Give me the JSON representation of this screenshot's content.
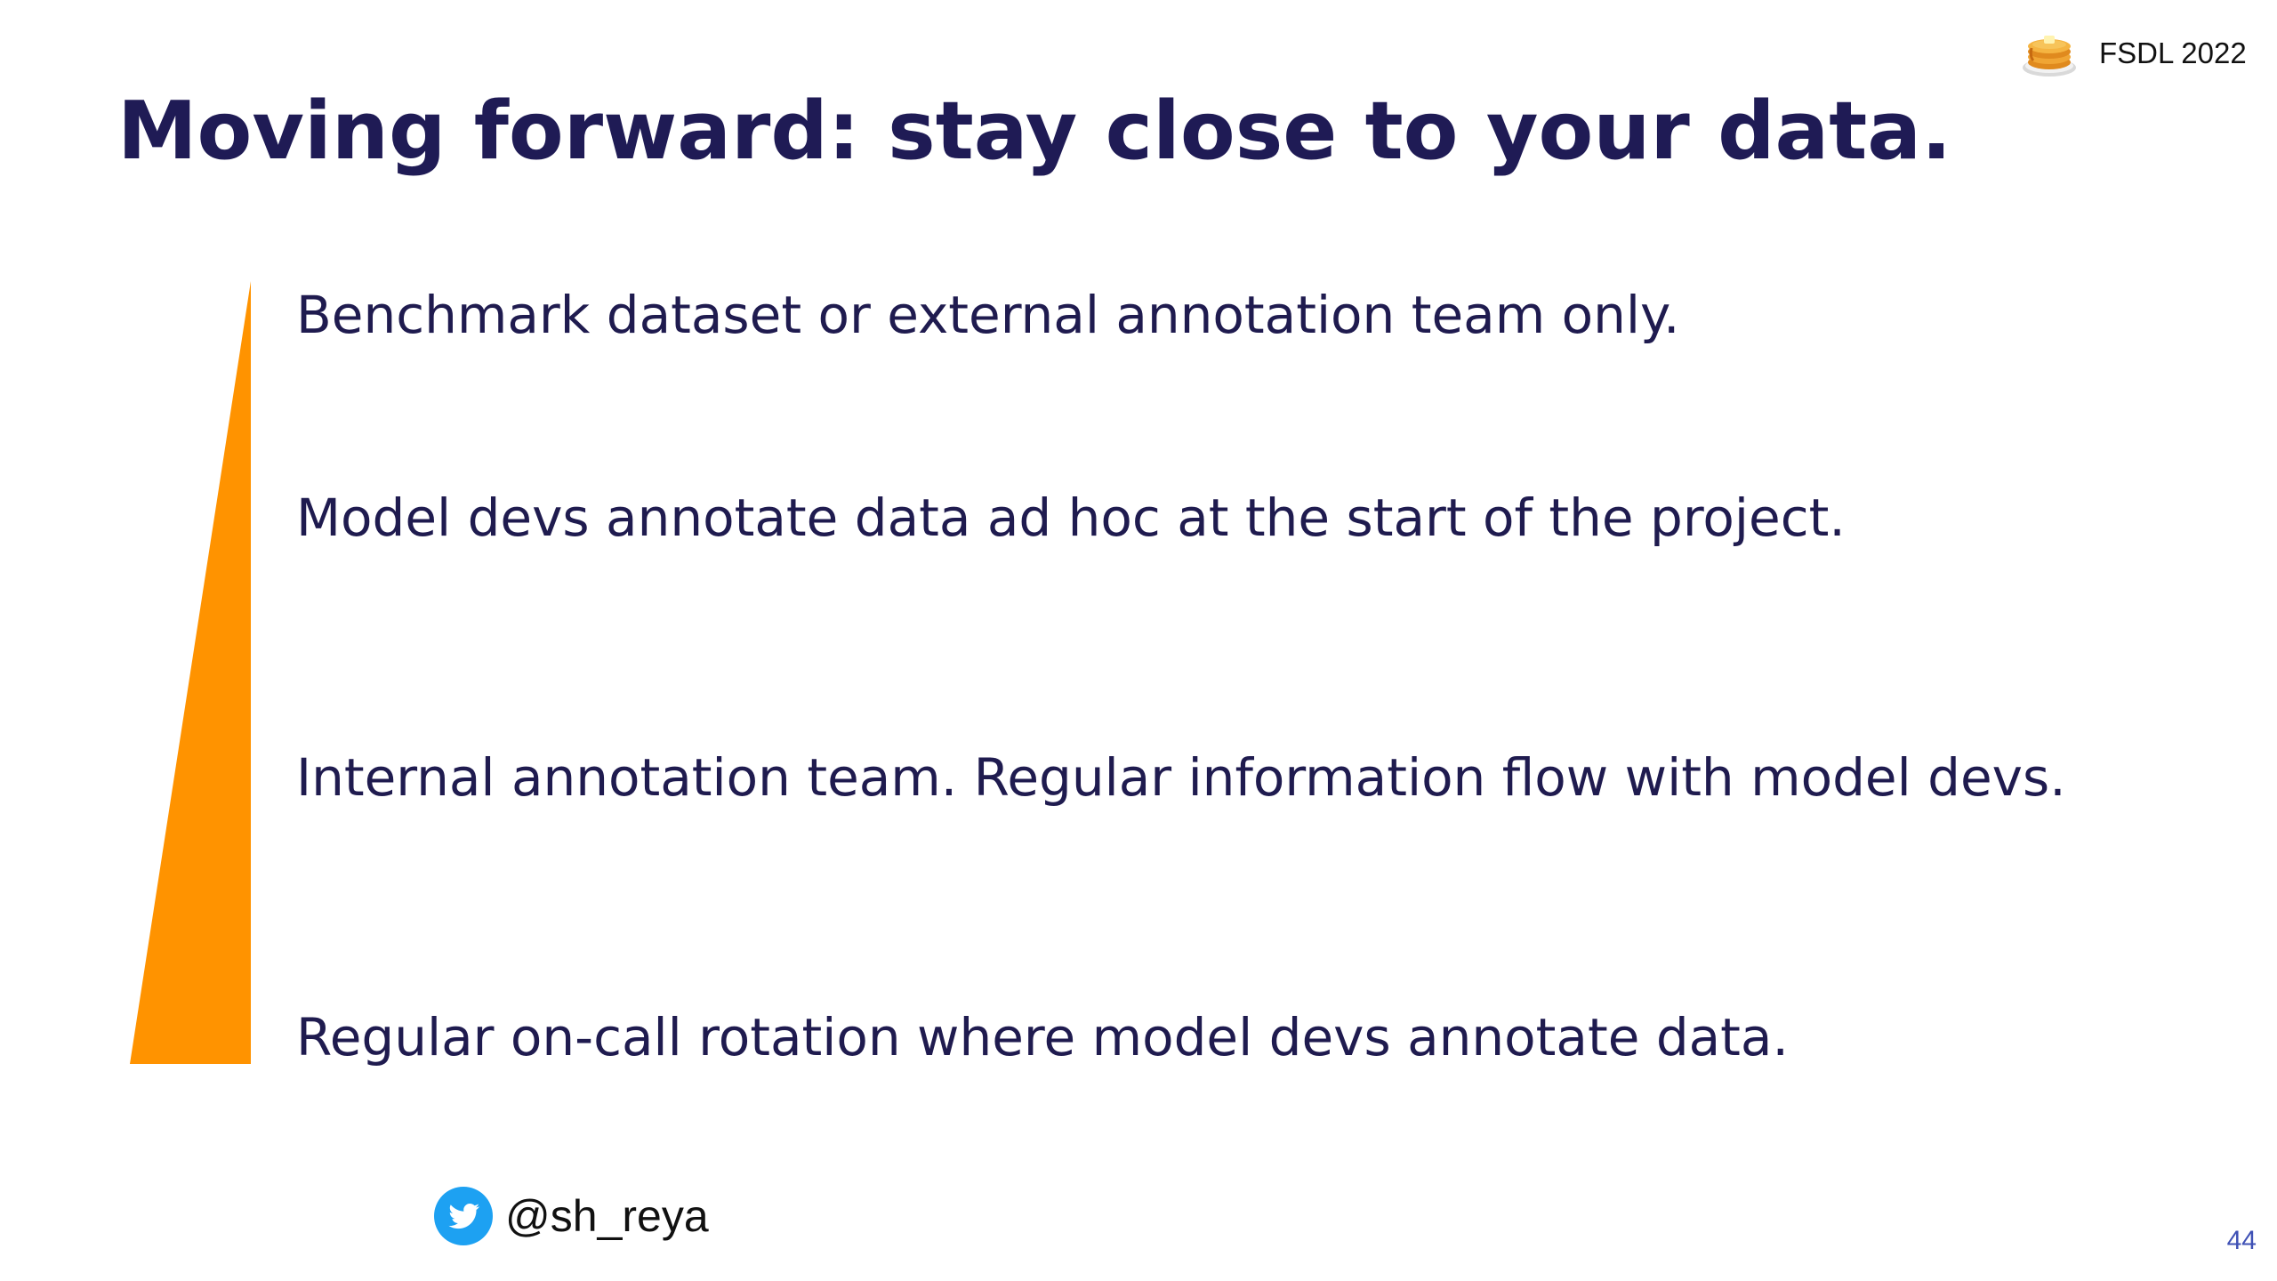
{
  "slide": {
    "title": "Moving forward: stay close to your data.",
    "brand": {
      "label": "FSDL 2022",
      "icon": "pancakes-icon"
    },
    "items": [
      "Benchmark dataset or external annotation team only.",
      "Model devs annotate data ad hoc at the start of the project.",
      "Internal annotation team. Regular information flow with model devs.",
      "Regular on-call rotation where model devs annotate data."
    ],
    "indicator": {
      "shape": "triangle-increasing-downward",
      "color": "#FF9300"
    },
    "social": {
      "icon": "twitter-icon",
      "handle": "@sh_reya"
    },
    "page_number": "44",
    "colors": {
      "title": "#1F1B55",
      "body_text": "#1F1B4F",
      "accent": "#FF9300",
      "page_number": "#3F51B5",
      "twitter": "#1DA1F2"
    }
  }
}
